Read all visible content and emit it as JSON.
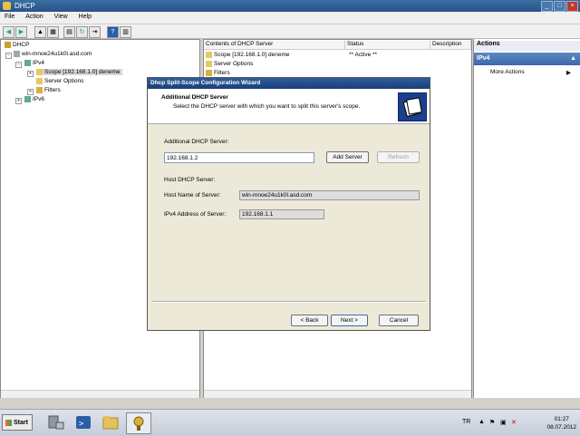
{
  "window": {
    "title": "DHCP"
  },
  "menu": [
    "File",
    "Action",
    "View",
    "Help"
  ],
  "tree": {
    "root": "DHCP",
    "server": "win-mnoe24u1k0l.asd.com",
    "ipv4": "IPv4",
    "scope": "Scope [192.168.1.0] deneme",
    "server_options": "Server Options",
    "filters": "Filters",
    "ipv6": "IPv6"
  },
  "list": {
    "columns": [
      "Contents of DHCP Server",
      "Status",
      "Description"
    ],
    "rows": [
      {
        "name": "Scope [192.168.1.0] deneme",
        "status": "** Active **"
      },
      {
        "name": "Server Options",
        "status": ""
      },
      {
        "name": "Filters",
        "status": ""
      }
    ]
  },
  "actions": {
    "header": "Actions",
    "section": "IPv4",
    "more": "More Actions"
  },
  "dialog": {
    "title": "Dhcp Split-Scope Configuration Wizard",
    "heading": "Additional DHCP Server",
    "subheading": "Select the DHCP server with which you want to split this server's scope.",
    "additional_label": "Additional DHCP Server:",
    "additional_value": "192.168.1.2",
    "add_server": "Add Server",
    "refresh": "Refresh",
    "host_section": "Host DHCP Server:",
    "host_name_label": "Host Name of Server:",
    "host_name_value": "win-mnoe24u1k0l.asd.com",
    "ipv4_label": "IPv4 Address of Server:",
    "ipv4_value": "192.168.1.1",
    "back": "< Back",
    "next": "Next >",
    "cancel": "Cancel"
  },
  "taskbar": {
    "start": "Start",
    "lang": "TR",
    "time": "01:27",
    "date": "08.07.2012"
  },
  "colors": {
    "titlebar": "#2a5385",
    "accent": "#3d67a8"
  }
}
